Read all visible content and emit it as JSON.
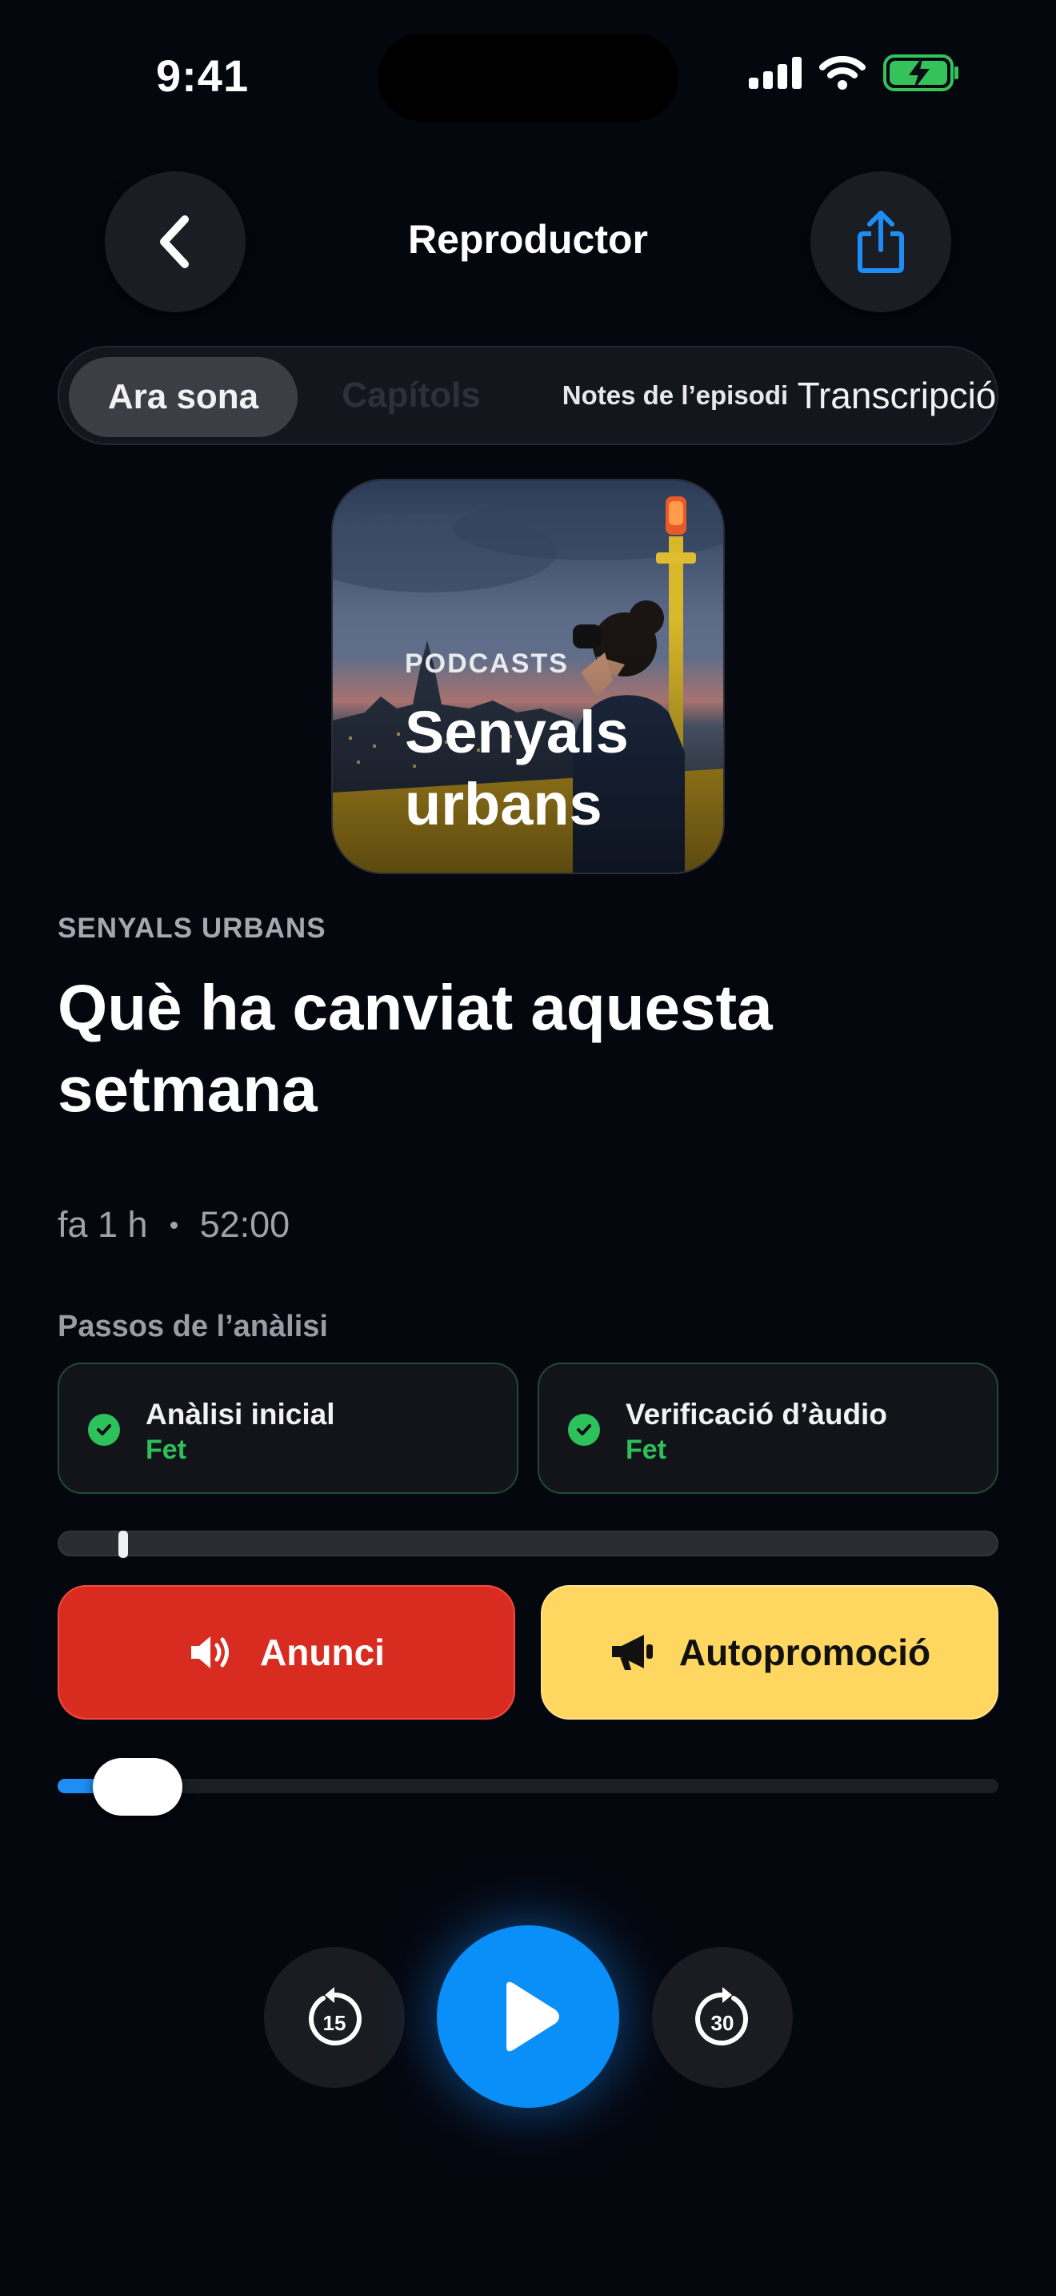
{
  "status_bar": {
    "time": "9:41"
  },
  "header": {
    "title": "Reproductor"
  },
  "tabs": [
    {
      "label": "Ara sona",
      "active": true
    },
    {
      "label": "Capítols"
    },
    {
      "label": "Notes de l’episodi"
    },
    {
      "label": "Transcripció"
    }
  ],
  "artwork": {
    "label": "PODCASTS",
    "title_line1": "Senyals",
    "title_line2": "urbans"
  },
  "episode": {
    "show": "SENYALS URBANS",
    "title": "Què ha canviat aquesta setmana",
    "published": "fa 1 h",
    "duration": "52:00"
  },
  "analysis": {
    "label": "Passos de l’anàlisi",
    "steps": [
      {
        "name": "Anàlisi inicial",
        "status": "Fet"
      },
      {
        "name": "Verificació d’àudio",
        "status": "Fet"
      }
    ]
  },
  "segments": {
    "marker_fraction": 0.07,
    "ad_label": "Anunci",
    "promo_label": "Autopromoció"
  },
  "playback": {
    "progress_fraction": 0.085
  },
  "controls": {
    "skip_back_seconds": "15",
    "skip_forward_seconds": "30"
  },
  "colors": {
    "accent": "#0a8ef7",
    "ad": "#d92c21",
    "promo": "#ffd660",
    "success": "#2dc15c"
  }
}
